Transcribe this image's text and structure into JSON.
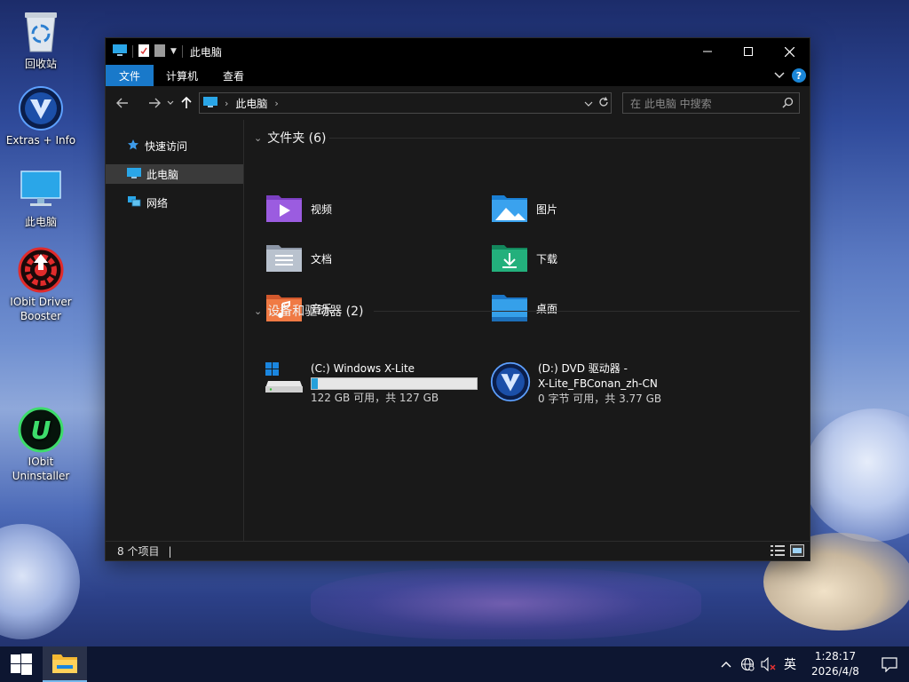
{
  "desktop": {
    "icons": [
      {
        "label": "回收站"
      },
      {
        "label": "Extras + Info"
      },
      {
        "label": "此电脑"
      },
      {
        "label": "IObit Driver Booster"
      },
      {
        "label": "IObit Uninstaller"
      }
    ]
  },
  "window": {
    "title": "此电脑",
    "ribbon_tabs": [
      "文件",
      "计算机",
      "查看"
    ],
    "help_label": "?",
    "address": {
      "breadcrumb": "此电脑"
    },
    "search_placeholder": "在 此电脑 中搜索",
    "sidebar": [
      {
        "label": "快速访问",
        "icon": "star-icon"
      },
      {
        "label": "此电脑",
        "icon": "computer-icon"
      },
      {
        "label": "网络",
        "icon": "network-icon"
      }
    ],
    "folders_header": "文件夹 (6)",
    "folders": [
      {
        "label": "视频",
        "icon": "videos-folder-icon"
      },
      {
        "label": "图片",
        "icon": "pictures-folder-icon"
      },
      {
        "label": "文档",
        "icon": "documents-folder-icon"
      },
      {
        "label": "下载",
        "icon": "downloads-folder-icon"
      },
      {
        "label": "音乐",
        "icon": "music-folder-icon"
      },
      {
        "label": "桌面",
        "icon": "desktop-folder-icon"
      }
    ],
    "devices_header": "设备和驱动器 (2)",
    "drives": [
      {
        "name": "(C:) Windows X-Lite",
        "space": "122 GB 可用，共 127 GB",
        "used_fraction": 0.039
      },
      {
        "name_line1": "(D:) DVD 驱动器 -",
        "name_line2": "X-Lite_FBConan_zh-CN",
        "space": "0 字节 可用，共 3.77 GB"
      }
    ],
    "status": "8 个项目",
    "status_cursor": "|"
  },
  "taskbar": {
    "ime": "英",
    "time": "1:28:17",
    "date": "2026/4/8"
  },
  "colors": {
    "accent": "#1979ca",
    "window_bg": "#191919",
    "taskbar_bg": "#0d1631"
  }
}
